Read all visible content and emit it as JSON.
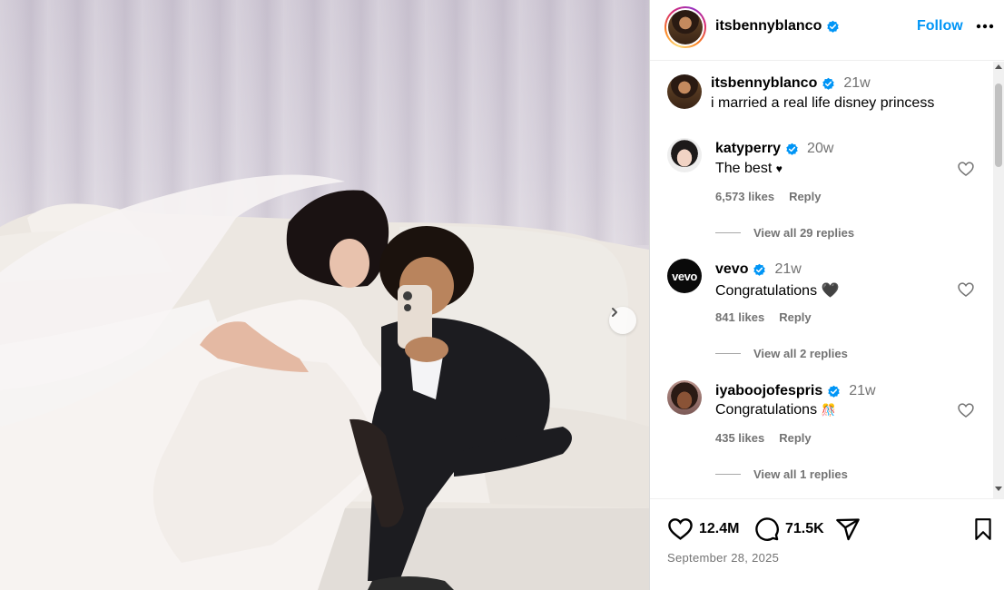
{
  "post": {
    "author": "itsbennyblanco",
    "follow_label": "Follow",
    "date": "September 28, 2025",
    "photo_alt": "post photo",
    "caption": {
      "username": "itsbennyblanco",
      "time": "21w",
      "text": "i married a real life disney princess"
    }
  },
  "comments": [
    {
      "username": "katyperry",
      "time": "20w",
      "text": "The best",
      "emoji": "♥",
      "likes": "6,573 likes",
      "reply_label": "Reply",
      "view_replies": "View all 29 replies",
      "avatar_icon": "katyperry-avatar"
    },
    {
      "username": "vevo",
      "time": "21w",
      "text": "Congratulations",
      "emoji": "🖤",
      "likes": "841 likes",
      "reply_label": "Reply",
      "view_replies": "View all 2 replies",
      "avatar_text": "vevo"
    },
    {
      "username": "iyaboojofespris",
      "time": "21w",
      "text": "Congratulations",
      "emoji": "🎊",
      "likes": "435 likes",
      "reply_label": "Reply",
      "view_replies": "View all 1 replies",
      "avatar_icon": "iyaboojofespris-avatar"
    }
  ],
  "actions": {
    "like_count": "12.4M",
    "comment_count": "71.5K"
  },
  "colors": {
    "accent": "#0095f6",
    "verified": "#0095f6",
    "muted": "#737373"
  },
  "icons": [
    "verified-badge-icon",
    "more-options-icon",
    "heart-icon",
    "comment-icon",
    "share-icon",
    "bookmark-icon",
    "chevron-right-icon"
  ]
}
